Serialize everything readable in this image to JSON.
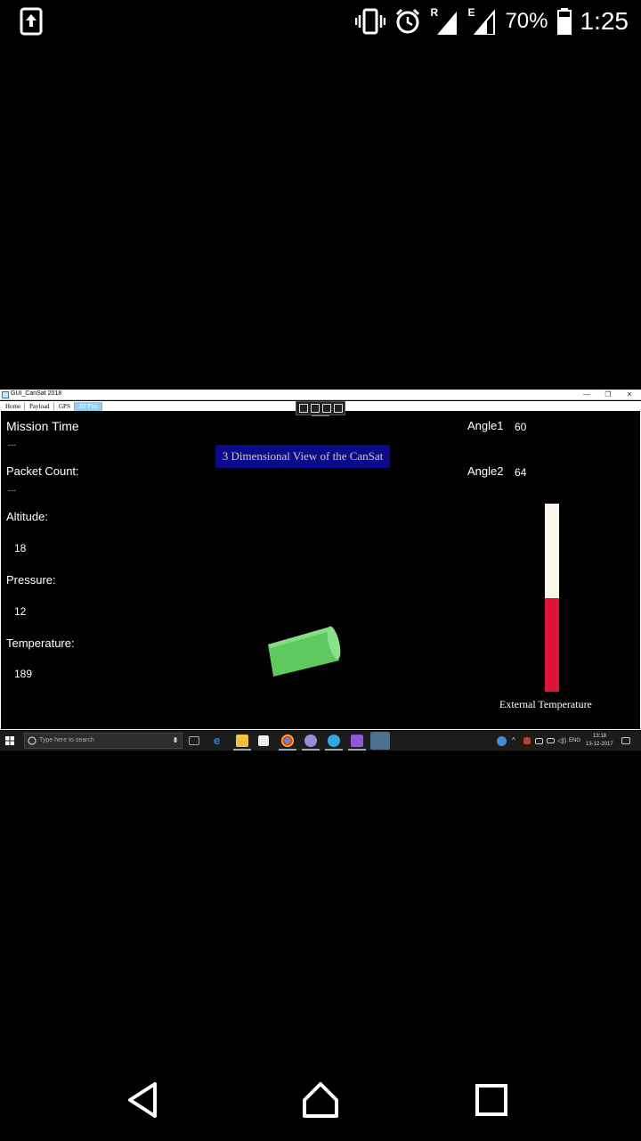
{
  "status_bar": {
    "icons": [
      "upload-icon",
      "vibrate-icon",
      "alarm-icon",
      "signal-roaming-icon",
      "signal-edge-icon",
      "battery-icon"
    ],
    "roaming_label": "R",
    "network_label": "E",
    "battery": "70%",
    "time": "1:25"
  },
  "window": {
    "title": "GUI_CanSat 2018",
    "controls": [
      "—",
      "❐",
      "✕"
    ],
    "tabs": [
      {
        "label": "Home",
        "active": false
      },
      {
        "label": "Payload",
        "active": false
      },
      {
        "label": "GPS",
        "active": false
      },
      {
        "label": "3D Plot",
        "active": true
      }
    ]
  },
  "telemetry": {
    "mission_time_label": "Mission Time",
    "mission_time_value": "---",
    "packet_count_label": "Packet Count:",
    "packet_count_value": "---",
    "altitude_label": "Altitude:",
    "altitude_value": "18",
    "pressure_label": "Pressure:",
    "pressure_value": "12",
    "temperature_label": "Temperature:",
    "temperature_value": "189",
    "angle1_label": "Angle1",
    "angle1_value": "60",
    "angle2_label": "Angle2",
    "angle2_value": "64"
  },
  "plot": {
    "title": "3 Dimensional View of the CanSat",
    "cansat_color": "#6cd36c"
  },
  "thermometer": {
    "label": "External Temperature",
    "fill_fraction": 0.5,
    "fill_color": "#dc143c",
    "empty_color": "#fbf4e8"
  },
  "taskbar": {
    "search_placeholder": "Type here to search",
    "language": "ENG",
    "clock_time": "13:18",
    "clock_date": "13-12-2017"
  }
}
